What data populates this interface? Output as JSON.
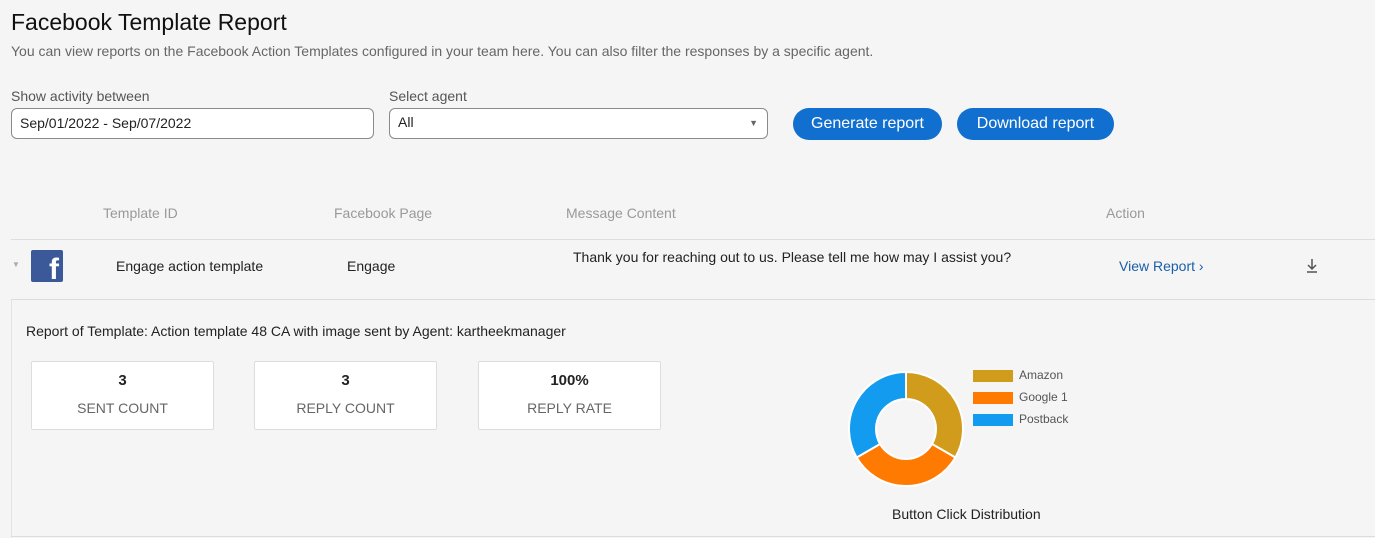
{
  "header": {
    "title": "Facebook Template Report",
    "subtitle": "You can view reports on the Facebook Action Templates configured in your team here. You can also filter the responses by a specific agent."
  },
  "filters": {
    "date_label": "Show activity between",
    "date_value": "Sep/01/2022 - Sep/07/2022",
    "agent_label": "Select agent",
    "agent_value": "All"
  },
  "buttons": {
    "generate": "Generate report",
    "download": "Download report"
  },
  "table": {
    "columns": [
      "Template ID",
      "Facebook Page",
      "Message Content",
      "Action"
    ],
    "row": {
      "template_id": "Engage action template",
      "page": "Engage",
      "message": "Thank you for reaching out to us. Please tell me how may I assist you?",
      "action": "View Report ›"
    }
  },
  "report": {
    "heading": "Report of Template: Action template 48 CA with image sent by Agent: kartheekmanager",
    "stats": [
      {
        "value": "3",
        "label": "SENT COUNT"
      },
      {
        "value": "3",
        "label": "REPLY COUNT"
      },
      {
        "value": "100%",
        "label": "REPLY RATE"
      }
    ]
  },
  "chart_data": {
    "type": "pie",
    "title": "Button Click Distribution",
    "categories": [
      "Amazon",
      "Google 1",
      "Postback"
    ],
    "values": [
      1,
      1,
      1
    ],
    "colors": [
      "#d19b1c",
      "#ff7a00",
      "#139bf0"
    ],
    "donut": true,
    "legend": "right"
  },
  "icons": {
    "facebook": "facebook-logo-icon",
    "download": "download-icon",
    "expand": "caret-down-icon",
    "select": "caret-down-icon"
  }
}
